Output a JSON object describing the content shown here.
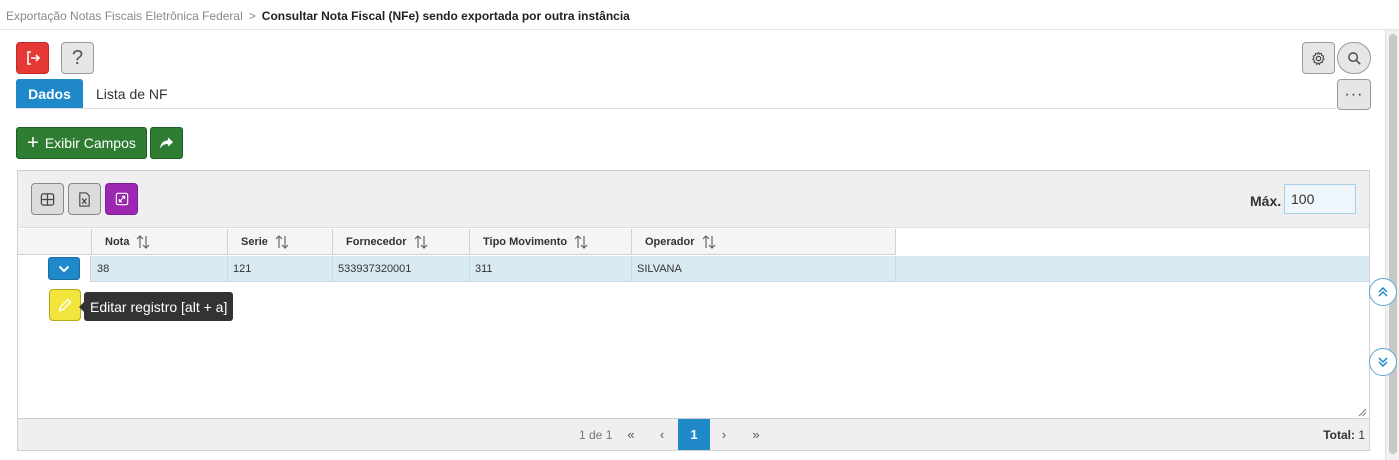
{
  "breadcrumb": {
    "parent": "Exportação Notas Fiscais Eletrônica Federal",
    "separator": ">",
    "current": "Consultar Nota Fiscal (NFe) sendo exportada por outra instância"
  },
  "toolbar": {
    "exit_icon": "exit-icon",
    "help_label": "?",
    "settings_icon": "gear-icon",
    "search_icon": "search-icon",
    "more_label": "···"
  },
  "tabs": [
    {
      "label": "Dados",
      "active": true
    },
    {
      "label": "Lista de NF",
      "active": false
    }
  ],
  "actions": {
    "show_fields_label": "Exibir Campos",
    "share_icon": "share-icon"
  },
  "grid": {
    "toolbar_icons": [
      "columns-icon",
      "excel-icon",
      "expand-icon"
    ],
    "max_label": "Máx.",
    "max_value": "100",
    "columns": [
      "Nota",
      "Serie",
      "Fornecedor",
      "Tipo Movimento",
      "Operador"
    ],
    "rows": [
      {
        "nota": "38",
        "serie": "121",
        "fornecedor": "533937320001",
        "tipo_movimento": "311",
        "operador": "SILVANA"
      }
    ],
    "edit_tooltip": "Editar registro [alt + a]"
  },
  "pager": {
    "page_info": "1 de 1",
    "first": "«",
    "prev": "‹",
    "current_page": "1",
    "next": "›",
    "last": "»",
    "total_label": "Total:",
    "total_value": "1"
  },
  "colors": {
    "accent_blue": "#1e88c8",
    "exit_red": "#e53935",
    "green": "#2e7d32",
    "purple": "#9c27b0",
    "edit_yellow": "#f2e53d",
    "row_selected": "#d8ebf2"
  }
}
